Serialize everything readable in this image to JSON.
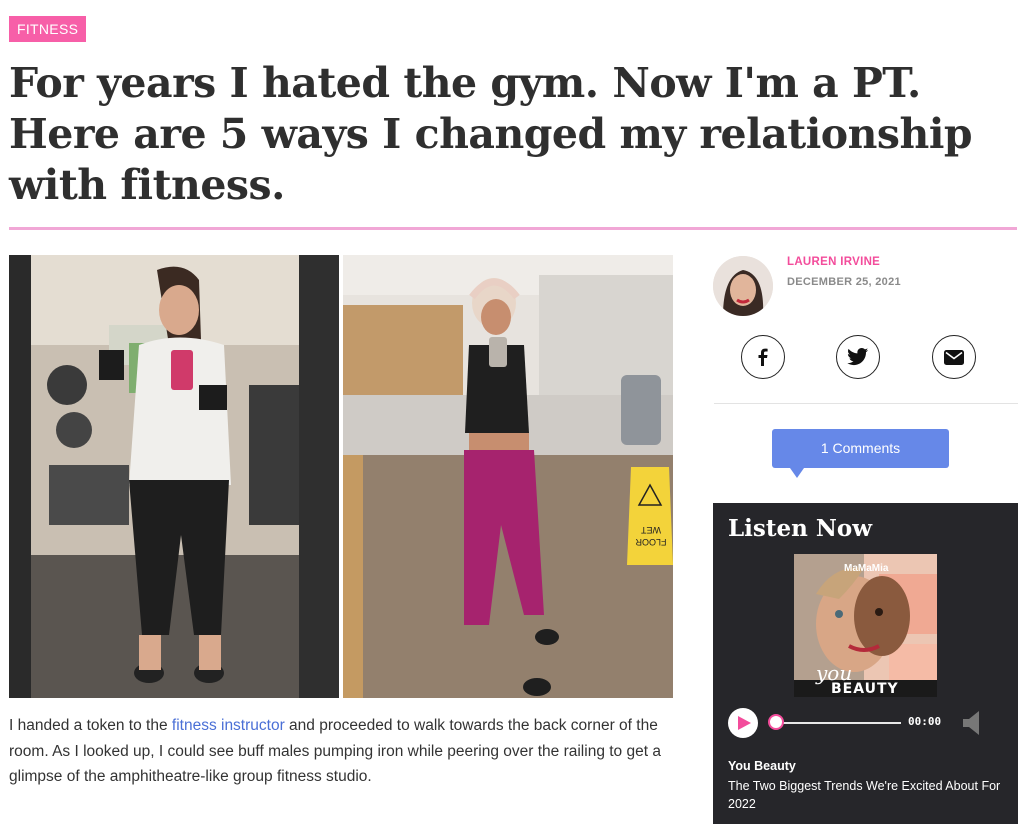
{
  "article": {
    "category": "FITNESS",
    "title": "For years I hated the gym. Now I'm a PT. Here are 5 ways I changed my relationship with fitness.",
    "body": {
      "before_link": "I handed a token to the ",
      "link_text": "fitness instructor",
      "after_link": " and proceeded to walk towards the back corner of the room. As I looked up, I could see buff males pumping iron while peering over the railing to get a glimpse of the amphitheatre-like group fitness studio."
    },
    "hero_sign_text": [
      "WET",
      "FLOOR"
    ]
  },
  "author": {
    "name": "LAUREN IRVINE",
    "date": "DECEMBER 25, 2021"
  },
  "share": {
    "icons": [
      "facebook-icon",
      "twitter-icon",
      "email-icon"
    ]
  },
  "comments": {
    "label": "1 Comments"
  },
  "podcast": {
    "heading": "Listen Now",
    "cover_brand": "MaMaMia",
    "cover_script": "you",
    "cover_title": "BEAUTY",
    "time": "00:00",
    "show": "You Beauty",
    "episode": "The Two Biggest Trends We're Excited About For 2022"
  },
  "colors": {
    "accent_pink": "#f75fa8",
    "button_blue": "#6688e8",
    "panel_dark": "#26262a"
  }
}
